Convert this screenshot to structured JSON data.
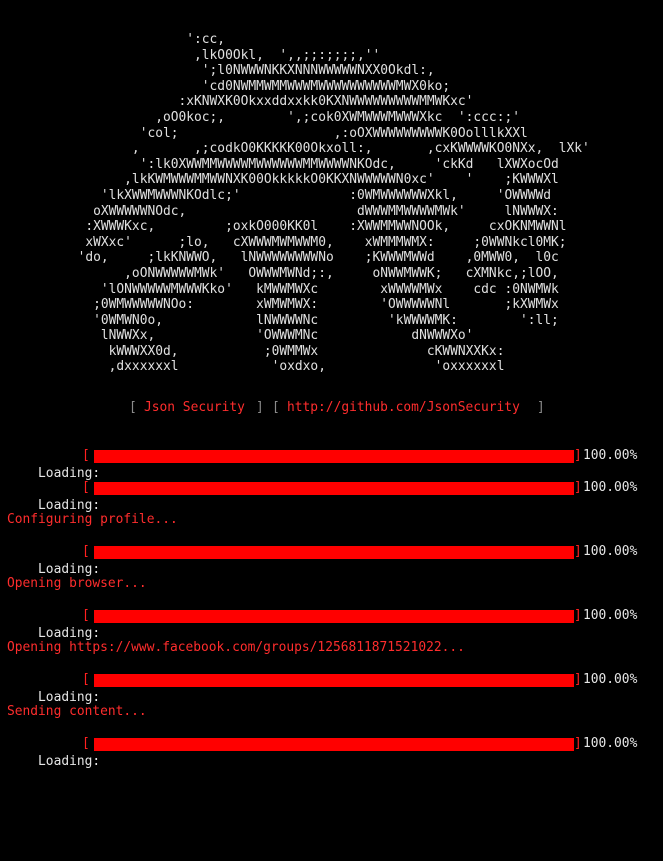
{
  "ascii_art": [
    "                        ':cc,",
    "                         ,lkO0Okl,  ',,;;:;;;;,''",
    "                          ';l0NWWWNKKXNNNWWWWWNXX0Okdl:,",
    "                          'cd0NWMMWMMWWWMWWWWWWWWWWMWX0ko;",
    "                       :xKNWXK0Okxxddxxkk0KXNWWWWWWWWWMMWKxc'",
    "                    ,oO0koc;,        ',;cok0XWMWWWMWWWXkc  ':ccc:;'",
    "                  'col;                    ,:oOXWWWWWWWWWK0OolllkXXl",
    "                 ,       ,;codkO0KKKKK00Okxoll:,       ,cxKWWWWKO0NXx,  lXk'",
    "                  ':lk0XWWMMWWWWMWWWWWWMMWWWWNKOdc,     'ckKd   lXWXocOd",
    "                ,lkKWMWWWMMWWNXK00OkkkkkO0KKXNWWWWWN0xc'    '    ;KWWWXl",
    "             'lkXWWMWWWNKOdlc;'              :0WMWWWWWWXkl,     'OWWWWd",
    "            oXWWWWWNOdc,                      dWWWMMWWWWMWk'     lNWWWX:",
    "           :XWWWKxc,         ;oxkO000KK0l    :XWWMMWWNOOk,     cxOKNMWWNl",
    "           xWXxc'      ;lo,   cXWWWMWMWWM0,    xWMMMWMX:     ;0WWNkcl0MK;",
    "          'do,     ;lkKNWWO,   lNWWWWWWWWNo    ;KWWWMWWd    ,0MWW0,  l0c",
    "                ,oONWWWWWMWk'   OWWWMWNd;:,     oNWWMWWK;   cXMNkc,;lOO,",
    "             'lONWWWWWMWWWKko'   kMWWMWXc        xWWWWMWx    cdc :0NWMWk",
    "            ;0WMWWWWWNOo:        xWMWMWX:        'OWWWWWNl       ;kXWMWx",
    "            '0WMWN0o,            lNWWWWNc         'kWWWWMK:        ':ll;",
    "             lNWWXx,             'OWWWMNc            dNWWWXo'",
    "              kWWWXX0d,           ;0WMMWx              cKWWNXXKx:",
    "              ,dxxxxxxl            'oxdxo,              'oxxxxxxl"
  ],
  "credits": {
    "open1": "[",
    "name": "Json Security",
    "close1": "]",
    "open2": "[",
    "url": "http://github.com/JsonSecurity",
    "close2": "]"
  },
  "progress_bars": [
    {
      "label": "Loading:",
      "open": "[",
      "close": "]",
      "percent_text": "100.00%",
      "progress": 1.0
    },
    {
      "label": "Loading:",
      "open": "[",
      "close": "]",
      "percent_text": "100.00%",
      "progress": 1.0
    },
    {
      "label": "Loading:",
      "open": "[",
      "close": "]",
      "percent_text": "100.00%",
      "progress": 1.0
    },
    {
      "label": "Loading:",
      "open": "[",
      "close": "]",
      "percent_text": "100.00%",
      "progress": 1.0
    },
    {
      "label": "Loading:",
      "open": "[",
      "close": "]",
      "percent_text": "100.00%",
      "progress": 1.0
    },
    {
      "label": "Loading:",
      "open": "[",
      "close": "]",
      "percent_text": "100.00%",
      "progress": 1.0
    }
  ],
  "status_messages": [
    "Configuring profile...",
    "Opening browser...",
    "Opening https://www.facebook.com/groups/1256811871521022...",
    "Sending content..."
  ],
  "colors": {
    "background": "#000000",
    "text": "#e6e6e6",
    "accent_red": "#ff0000",
    "status_red": "#ff2d2d",
    "bracket_gray": "#8a8a8a"
  }
}
